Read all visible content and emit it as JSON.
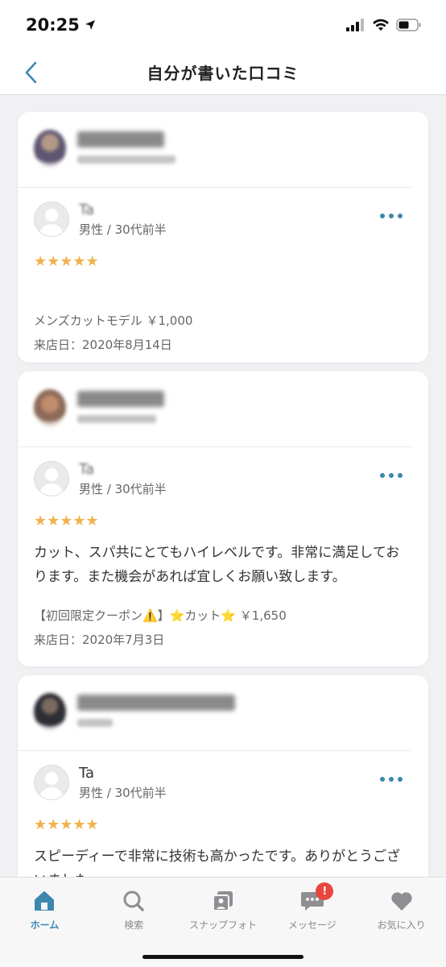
{
  "status_bar": {
    "time": "20:25"
  },
  "nav": {
    "title": "自分が書いた口コミ"
  },
  "reviews": [
    {
      "user": {
        "name": "Ta",
        "meta": "男性 / 30代前半"
      },
      "stars": "★★★★★",
      "text": "",
      "coupon": "メンズカットモデル ￥1,000",
      "visit_date": "来店日：2020年8月14日"
    },
    {
      "user": {
        "name": "Ta",
        "meta": "男性 / 30代前半"
      },
      "stars": "★★★★★",
      "text": "カット、スパ共にとてもハイレベルです。非常に満足しております。また機会があれば宜しくお願い致します。",
      "coupon": "【初回限定クーポン⚠️】⭐️カット⭐️ ￥1,650",
      "visit_date": "来店日：2020年7月3日"
    },
    {
      "user": {
        "name": "Ta",
        "meta": "男性 / 30代前半"
      },
      "stars": "★★★★★",
      "text": "スピーディーで非常に技術も高かったです。ありがとうございました",
      "coupon": "",
      "visit_date": ""
    }
  ],
  "tabs": [
    {
      "label": "ホーム",
      "icon": "home-icon",
      "active": true
    },
    {
      "label": "検索",
      "icon": "search-icon"
    },
    {
      "label": "スナップフォト",
      "icon": "snap-photo-icon"
    },
    {
      "label": "メッセージ",
      "icon": "message-icon",
      "badge": "!"
    },
    {
      "label": "お気に入り",
      "icon": "heart-icon"
    }
  ],
  "colors": {
    "accent": "#3d86b0",
    "star": "#f0b24e",
    "badge": "#e8473d"
  }
}
